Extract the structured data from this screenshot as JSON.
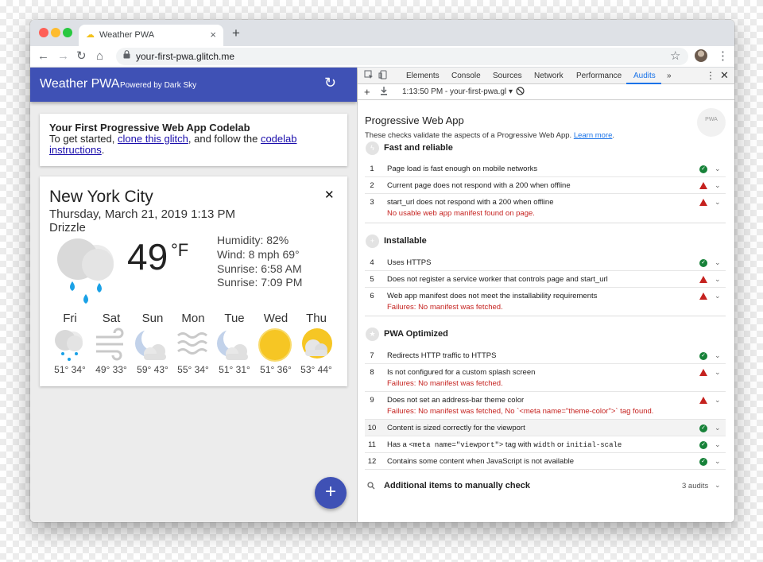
{
  "browser": {
    "tab_title": "Weather PWA",
    "url": "your-first-pwa.glitch.me",
    "buttons": {
      "back": "←",
      "forward": "→",
      "reload": "↻",
      "home": "⌂",
      "new_tab": "+",
      "close_tab": "×",
      "star": "☆",
      "menu": "⋮",
      "lock": "🔒"
    }
  },
  "app": {
    "title": "Weather PWA",
    "powered": "Powered by Dark Sky",
    "refresh_icon": "↻",
    "intro": {
      "heading": "Your First Progressive Web App Codelab",
      "text_a": "To get started, ",
      "link_a": "clone this glitch",
      "text_b": ", and follow the ",
      "link_b": "codelab instructions",
      "text_c": "."
    },
    "weather": {
      "city": "New York City",
      "date": "Thursday, March 21, 2019 1:13 PM",
      "description": "Drizzle",
      "temperature": "49",
      "unit": "°F",
      "close_icon": "✕",
      "humidity": "Humidity: 82%",
      "wind": "Wind: 8 mph 69°",
      "sunrise": "Sunrise: 6:58 AM",
      "sunset": "Sunrise: 7:09 PM",
      "forecast": [
        {
          "day": "Fri",
          "icon": "drizzle-icon",
          "temps": "51° 34°"
        },
        {
          "day": "Sat",
          "icon": "wind-icon",
          "temps": "49° 33°"
        },
        {
          "day": "Sun",
          "icon": "partly-cloudy-night-icon",
          "temps": "59° 43°"
        },
        {
          "day": "Mon",
          "icon": "fog-icon",
          "temps": "55° 34°"
        },
        {
          "day": "Tue",
          "icon": "partly-cloudy-night-icon",
          "temps": "51° 31°"
        },
        {
          "day": "Wed",
          "icon": "clear-day-icon",
          "temps": "51° 36°"
        },
        {
          "day": "Thu",
          "icon": "partly-cloudy-day-icon",
          "temps": "53° 44°"
        }
      ]
    },
    "fab_label": "+"
  },
  "devtools": {
    "tabs": [
      "Elements",
      "Console",
      "Sources",
      "Network",
      "Performance",
      "Audits",
      "»"
    ],
    "active_tab": "Audits",
    "report_select": "1:13:50 PM - your-first-pwa.gl",
    "audits": {
      "title": "Progressive Web App",
      "subtitle": "These checks validate the aspects of a Progressive Web App.",
      "learn_more": "Learn more",
      "badge": "PWA",
      "sections": [
        {
          "title": "Fast and reliable",
          "icon": "lightning-icon"
        },
        {
          "title": "Installable",
          "icon": "plus-icon"
        },
        {
          "title": "PWA Optimized",
          "icon": "star-icon"
        }
      ],
      "items": [
        {
          "num": "1",
          "text": "Page load is fast enough on mobile networks",
          "status": "pass"
        },
        {
          "num": "2",
          "text": "Current page does not respond with a 200 when offline",
          "status": "fail"
        },
        {
          "num": "3",
          "text": "start_url does not respond with a 200 when offline",
          "status": "fail",
          "error": "No usable web app manifest found on page."
        },
        {
          "num": "4",
          "text": "Uses HTTPS",
          "status": "pass"
        },
        {
          "num": "5",
          "text": "Does not register a service worker that controls page and start_url",
          "status": "fail"
        },
        {
          "num": "6",
          "text": "Web app manifest does not meet the installability requirements",
          "status": "fail",
          "error": "Failures: No manifest was fetched."
        },
        {
          "num": "7",
          "text": "Redirects HTTP traffic to HTTPS",
          "status": "pass"
        },
        {
          "num": "8",
          "text": "Is not configured for a custom splash screen",
          "status": "fail",
          "error": "Failures: No manifest was fetched."
        },
        {
          "num": "9",
          "text": "Does not set an address-bar theme color",
          "status": "fail",
          "error": "Failures: No manifest was fetched, No `<meta name=\"theme-color\">` tag found."
        },
        {
          "num": "10",
          "text": "Content is sized correctly for the viewport",
          "status": "pass"
        },
        {
          "num": "11",
          "text_a": "Has a ",
          "code_a": "<meta name=\"viewport\">",
          "text_b": " tag with ",
          "code_b": "width",
          "text_c": " or ",
          "code_c": "initial-scale",
          "status": "pass"
        },
        {
          "num": "12",
          "text": "Contains some content when JavaScript is not available",
          "status": "pass"
        }
      ],
      "manual": {
        "title": "Additional items to manually check",
        "count": "3 audits"
      }
    }
  },
  "colors": {
    "app_bar": "#3f51b5",
    "fail": "#c5221f",
    "pass": "#178239",
    "devtools_accent": "#1a73e8"
  }
}
